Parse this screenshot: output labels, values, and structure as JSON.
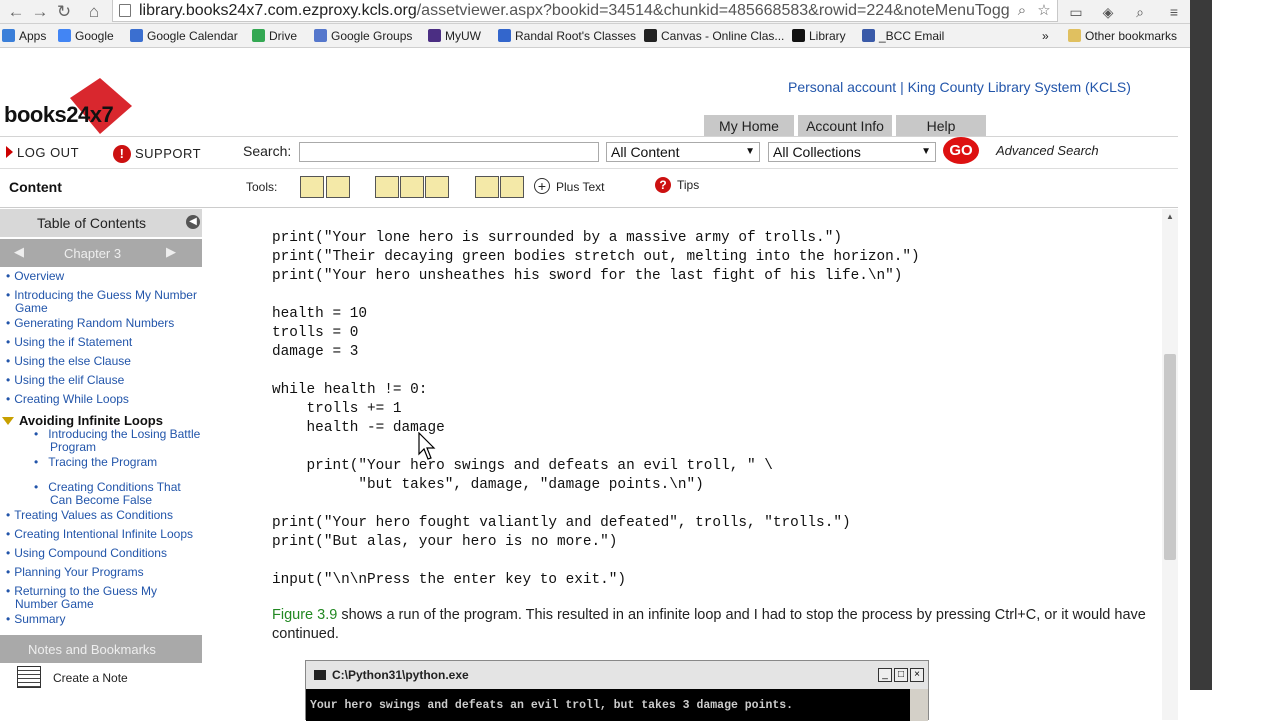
{
  "browser": {
    "url_host": "library.books24x7.com.ezproxy.kcls.org",
    "url_rest": "/assetviewer.aspx?bookid=34514&chunkid=485668583&rowid=224&noteMenuTogg",
    "bookmarks": [
      {
        "label": "Apps",
        "color": "#3b7fd9"
      },
      {
        "label": "Google",
        "color": "#4285f4"
      },
      {
        "label": "Google Calendar",
        "color": "#3b6fd0"
      },
      {
        "label": "Drive",
        "color": "#34a853"
      },
      {
        "label": "Google Groups",
        "color": "#5577cc"
      },
      {
        "label": "MyUW",
        "color": "#4b2e83"
      },
      {
        "label": "Randal Root's Classes",
        "color": "#3366cc"
      },
      {
        "label": "Canvas - Online Clas...",
        "color": "#222222"
      },
      {
        "label": "Library",
        "color": "#111111"
      },
      {
        "label": "_BCC Email",
        "color": "#3a5aa8"
      }
    ],
    "more_label": "»",
    "other_bookmarks": "Other bookmarks"
  },
  "site": {
    "logo_text": "books24x7",
    "account_text": "Personal account | King County Library System (KCLS)",
    "tabs": [
      "My Home",
      "Account Info",
      "Help"
    ],
    "logout": "LOG OUT",
    "support": "SUPPORT",
    "search_label": "Search:",
    "search_value": "",
    "content_select": "All Content",
    "collections_select": "All Collections",
    "go": "GO",
    "advanced": "Advanced Search",
    "content_heading": "Content",
    "tools_label": "Tools:",
    "plus_text": "Plus Text",
    "tips": "Tips",
    "accent_red": "#cc1111"
  },
  "sidebar": {
    "toc_title": "Table of Contents",
    "chapter": "Chapter 3",
    "items_before": [
      "Overview",
      "Introducing the Guess My Number Game",
      "Generating Random Numbers",
      "Using the if Statement",
      "Using the else Clause",
      "Using the elif Clause",
      "Creating While Loops"
    ],
    "active": "Avoiding Infinite Loops",
    "subitems": [
      "Introducing the Losing Battle Program",
      "Tracing the Program",
      "Creating Conditions That Can Become False"
    ],
    "items_after": [
      "Treating Values as Conditions",
      "Creating Intentional Infinite Loops",
      "Using Compound Conditions",
      "Planning Your Programs",
      "Returning to the Guess My Number Game",
      "Summary"
    ],
    "notes_title": "Notes and Bookmarks",
    "create_note": "Create a Note"
  },
  "main": {
    "code_lines": [
      "print(\"Your lone hero is surrounded by a massive army of trolls.\")",
      "print(\"Their decaying green bodies stretch out, melting into the horizon.\")",
      "print(\"Your hero unsheathes his sword for the last fight of his life.\\n\")",
      "",
      "health = 10",
      "trolls = 0",
      "damage = 3",
      "",
      "while health != 0:",
      "    trolls += 1",
      "    health -= damage",
      "",
      "    print(\"Your hero swings and defeats an evil troll, \" \\",
      "          \"but takes\", damage, \"damage points.\\n\")",
      "",
      "print(\"Your hero fought valiantly and defeated\", trolls, \"trolls.\")",
      "print(\"But alas, your hero is no more.\")",
      "",
      "input(\"\\n\\nPress the enter key to exit.\")"
    ],
    "figure_link": "Figure 3.9",
    "paragraph": " shows a run of the program. This resulted in an infinite loop and I had to stop the process by pressing Ctrl+C, or it would have continued.",
    "console_title": "C:\\Python31\\python.exe",
    "console_line": "Your hero swings and defeats an evil troll, but takes 3 damage points."
  }
}
